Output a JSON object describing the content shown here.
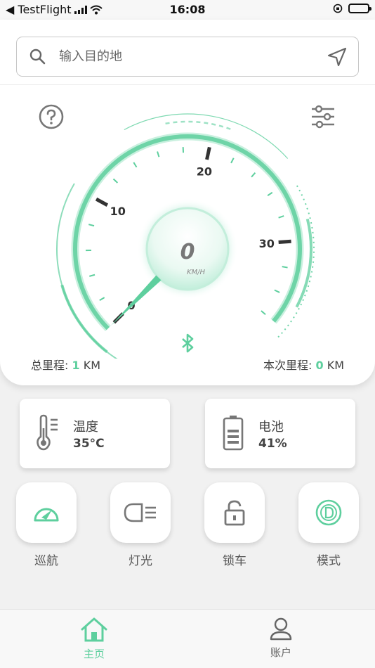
{
  "status_bar": {
    "back_label": "◀ TestFlight",
    "time": "16:08"
  },
  "search": {
    "placeholder": "输入目的地"
  },
  "speedometer": {
    "speed": "0",
    "unit": "KM/H",
    "ticks": [
      "0",
      "10",
      "20",
      "30"
    ],
    "needle_value": 0,
    "max_value": 36
  },
  "odometer": {
    "total_label": "总里程: ",
    "total_value": "1",
    "total_unit": " KM",
    "trip_label": "本次里程: ",
    "trip_value": "0",
    "trip_unit": " KM"
  },
  "cards": {
    "temperature": {
      "title": "温度",
      "value": "35°C"
    },
    "battery": {
      "title": "电池",
      "value": "41%"
    }
  },
  "actions": [
    {
      "label": "巡航",
      "icon": "speedometer-icon"
    },
    {
      "label": "灯光",
      "icon": "headlight-icon"
    },
    {
      "label": "锁车",
      "icon": "lock-icon"
    },
    {
      "label": "模式",
      "icon": "mode-d-icon"
    }
  ],
  "tabs": {
    "home": "主页",
    "account": "账户"
  },
  "colors": {
    "accent": "#5ecf9e",
    "text": "#444444",
    "background": "#f1f1f1"
  }
}
